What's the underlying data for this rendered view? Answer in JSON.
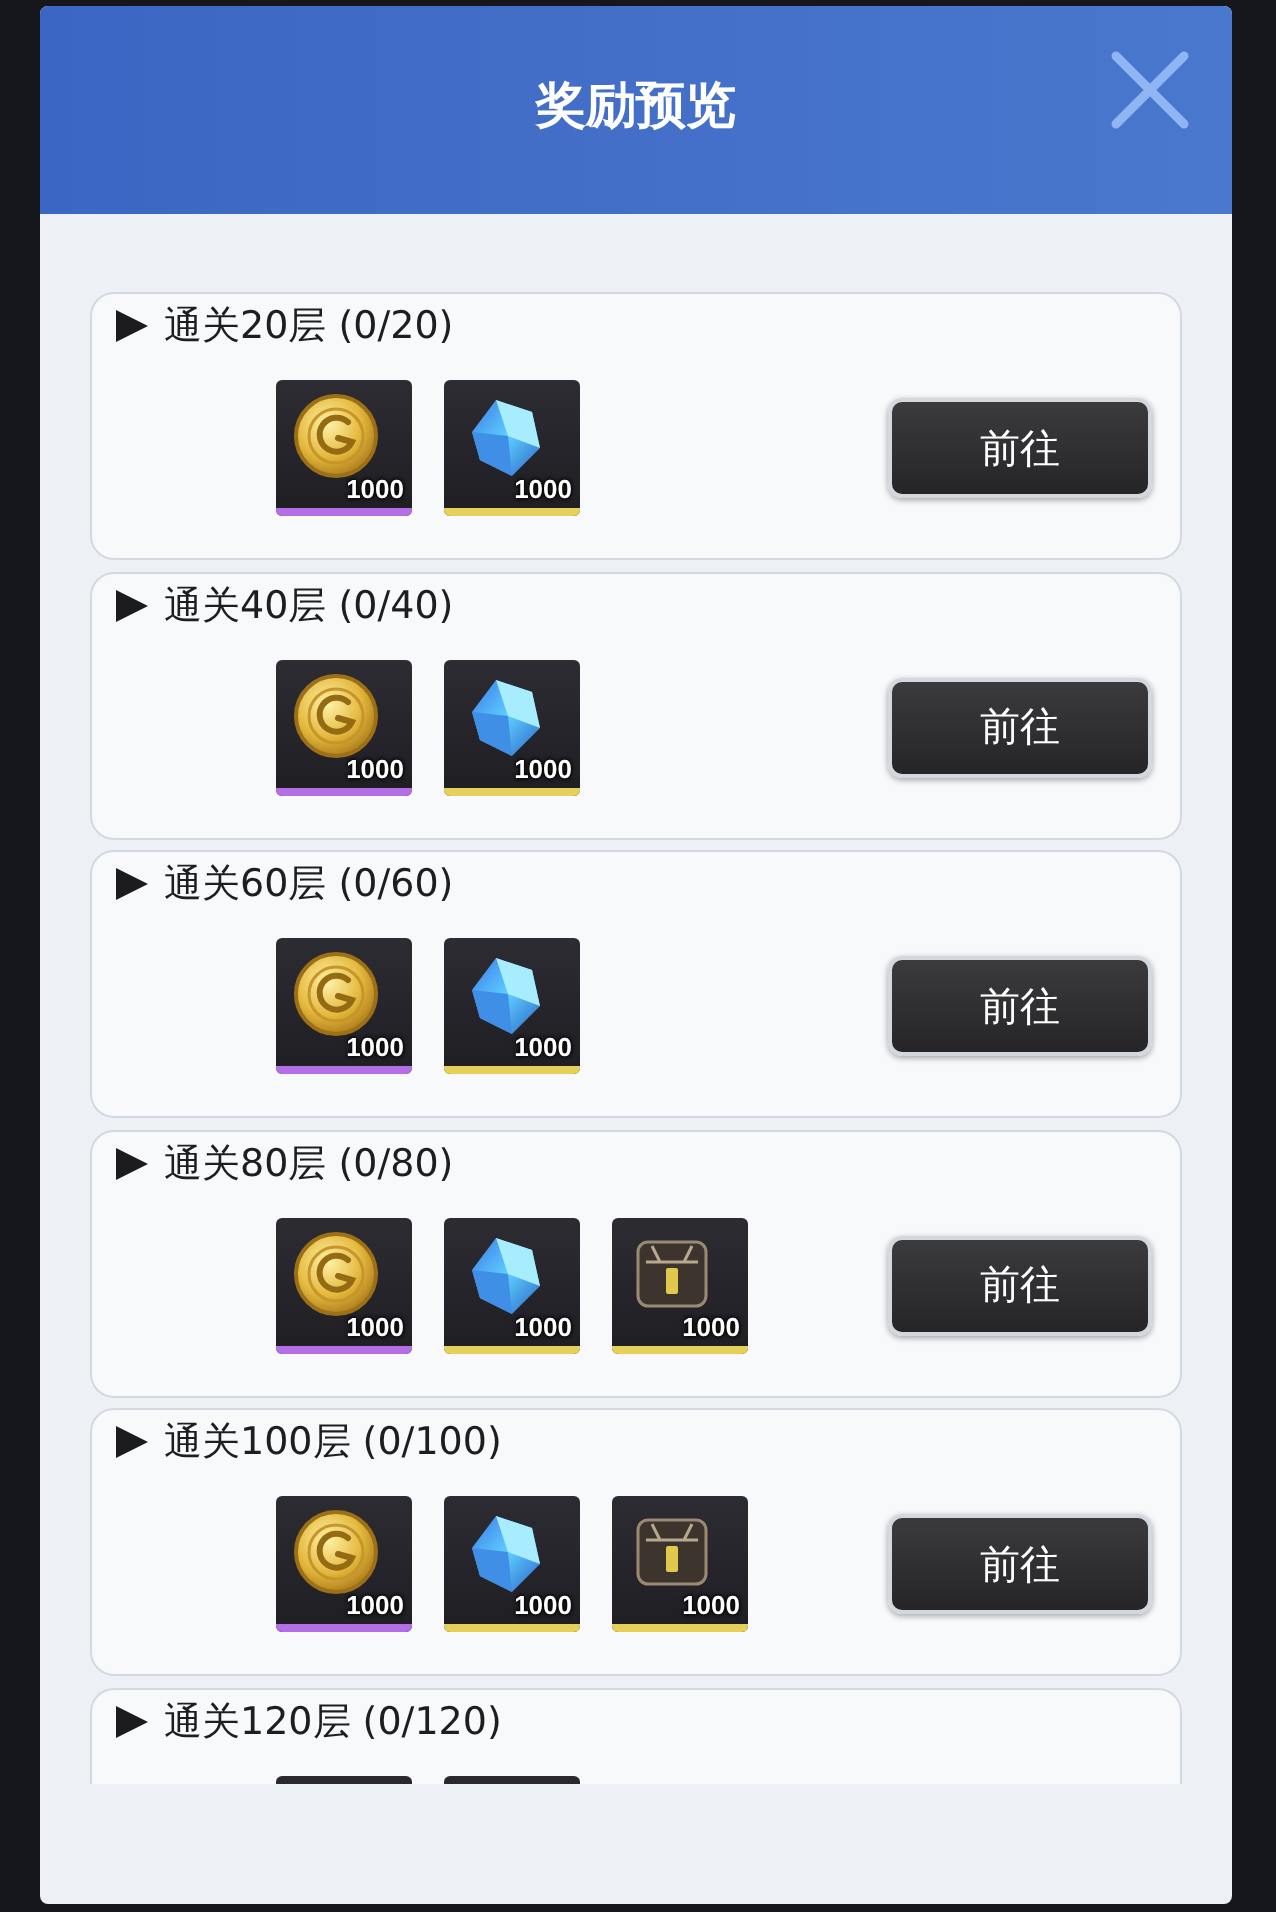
{
  "dialog": {
    "title": "奖励预览"
  },
  "tasks": [
    {
      "title": "通关20层 (0/20)",
      "rewards": [
        {
          "kind": "coin",
          "amount": "1000",
          "color": "#b46ee6"
        },
        {
          "kind": "crystal",
          "amount": "1000",
          "color": "#e6d05a"
        }
      ],
      "button": "前往"
    },
    {
      "title": "通关40层 (0/40)",
      "rewards": [
        {
          "kind": "coin",
          "amount": "1000",
          "color": "#b46ee6"
        },
        {
          "kind": "crystal",
          "amount": "1000",
          "color": "#e6d05a"
        }
      ],
      "button": "前往"
    },
    {
      "title": "通关60层 (0/60)",
      "rewards": [
        {
          "kind": "coin",
          "amount": "1000",
          "color": "#b46ee6"
        },
        {
          "kind": "crystal",
          "amount": "1000",
          "color": "#e6d05a"
        }
      ],
      "button": "前往"
    },
    {
      "title": "通关80层 (0/80)",
      "rewards": [
        {
          "kind": "coin",
          "amount": "1000",
          "color": "#b46ee6"
        },
        {
          "kind": "crystal",
          "amount": "1000",
          "color": "#e6d05a"
        },
        {
          "kind": "chest",
          "amount": "1000",
          "color": "#e6d05a"
        }
      ],
      "button": "前往"
    },
    {
      "title": "通关100层 (0/100)",
      "rewards": [
        {
          "kind": "coin",
          "amount": "1000",
          "color": "#b46ee6"
        },
        {
          "kind": "crystal",
          "amount": "1000",
          "color": "#e6d05a"
        },
        {
          "kind": "chest",
          "amount": "1000",
          "color": "#e6d05a"
        }
      ],
      "button": "前往"
    },
    {
      "title": "通关120层 (0/120)",
      "rewards": [
        {
          "kind": "partial"
        },
        {
          "kind": "partial"
        }
      ]
    }
  ]
}
